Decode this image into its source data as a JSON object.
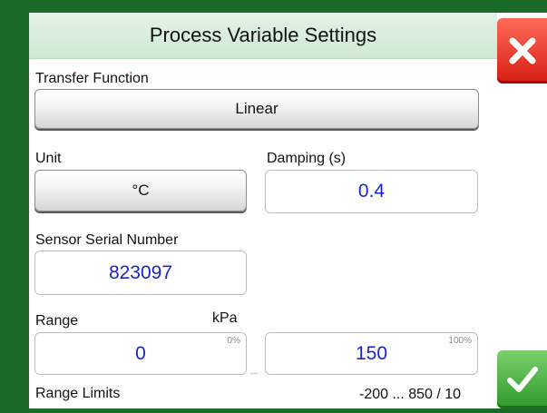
{
  "dialog": {
    "title": "Process Variable Settings"
  },
  "transfer_function": {
    "label": "Transfer Function",
    "value": "Linear"
  },
  "unit": {
    "label": "Unit",
    "value": "°C"
  },
  "damping": {
    "label": "Damping (s)",
    "value": "0.4"
  },
  "sensor_serial": {
    "label": "Sensor Serial Number",
    "value": "823097"
  },
  "range": {
    "label": "Range",
    "unit": "kPa",
    "low_value": "0",
    "low_pct": "0%",
    "separator": "...",
    "high_value": "150",
    "high_pct": "100%"
  },
  "range_limits": {
    "label": "Range Limits",
    "value": "-200 ... 850 / 10"
  },
  "icons": {
    "cancel": "close-icon",
    "accept": "checkmark-icon"
  },
  "colors": {
    "frame": "#1a6a2a",
    "title_bg": "#d8eedc",
    "value_text": "#1a25c9",
    "cancel": "#e0281c",
    "accept": "#3aa83a"
  }
}
